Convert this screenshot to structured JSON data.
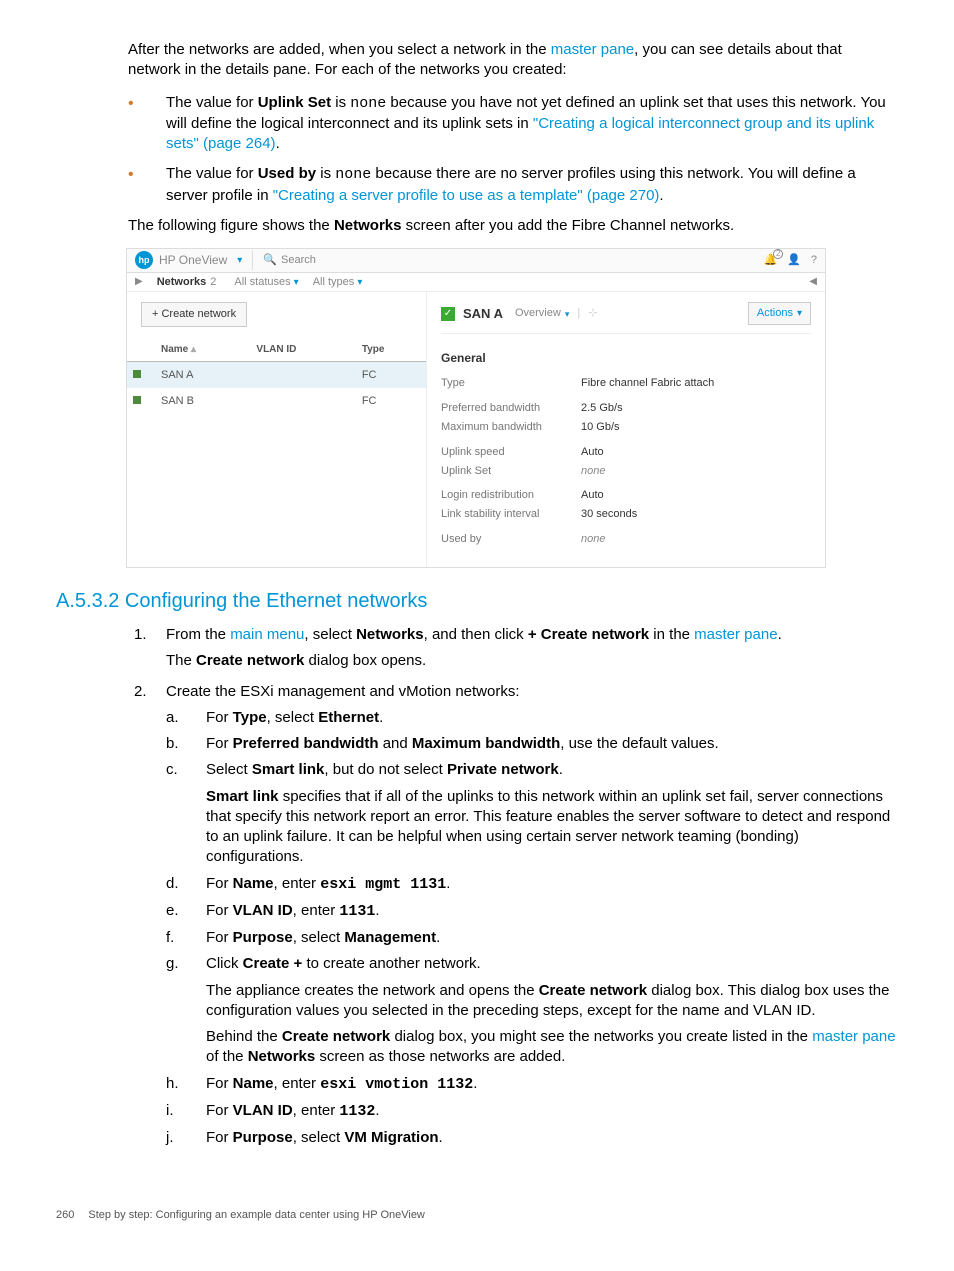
{
  "intro": {
    "p1a": "After the networks are added, when you select a network in the ",
    "p1link": "master pane",
    "p1b": ", you can see details about that network in the details pane. For each of the networks you created:",
    "b1a": "The value for ",
    "b1bold": "Uplink Set",
    "b1b": " is ",
    "b1mono": "none",
    "b1c": " because you have not yet defined an uplink set that uses this network. You will define the logical interconnect and its uplink sets in ",
    "b1link": "\"Creating a logical interconnect group and its uplink sets\" (page 264)",
    "b1d": ".",
    "b2a": "The value for ",
    "b2bold": "Used by",
    "b2b": " is ",
    "b2mono": "none",
    "b2c": " because there are no server profiles using this network. You will define a server profile in ",
    "b2link": "\"Creating a server profile to use as a template\" (page 270)",
    "b2d": ".",
    "p2a": "The following figure shows the ",
    "p2bold": "Networks",
    "p2b": " screen after you add the Fibre Channel networks."
  },
  "shot": {
    "topTitle": "HP OneView",
    "search": "Search",
    "badge": "2",
    "subLabel": "Networks",
    "subCount": "2",
    "filter1": "All statuses",
    "filter2": "All types",
    "createBtn": "+ Create network",
    "cols": {
      "name": "Name",
      "vlan": "VLAN ID",
      "type": "Type"
    },
    "rows": [
      {
        "name": "SAN A",
        "vlan": "",
        "type": "FC",
        "sel": true
      },
      {
        "name": "SAN B",
        "vlan": "",
        "type": "FC",
        "sel": false
      }
    ],
    "rp": {
      "title": "SAN A",
      "overview": "Overview",
      "actions": "Actions",
      "general": "General",
      "kv": [
        [
          {
            "k": "Type",
            "v": "Fibre channel Fabric attach"
          }
        ],
        [
          {
            "k": "Preferred bandwidth",
            "v": "2.5 Gb/s"
          },
          {
            "k": "Maximum bandwidth",
            "v": "10 Gb/s"
          }
        ],
        [
          {
            "k": "Uplink speed",
            "v": "Auto"
          },
          {
            "k": "Uplink Set",
            "v": "none",
            "it": true
          }
        ],
        [
          {
            "k": "Login redistribution",
            "v": "Auto"
          },
          {
            "k": "Link stability interval",
            "v": "30 seconds"
          }
        ],
        [
          {
            "k": "Used by",
            "v": "none",
            "it": true
          }
        ]
      ]
    }
  },
  "section": {
    "heading": "A.5.3.2 Configuring the Ethernet networks",
    "step1a": "From the ",
    "step1link1": "main menu",
    "step1b": ", select ",
    "step1bold1": "Networks",
    "step1c": ", and then click ",
    "step1bold2": "+ Create network",
    "step1d": " in the ",
    "step1link2": "master pane",
    "step1e": ".",
    "step1p2a": "The ",
    "step1p2bold": "Create network",
    "step1p2b": " dialog box opens.",
    "step2": "Create the ESXi management and vMotion networks:",
    "sa": {
      "t1": "For ",
      "b1": "Type",
      "t2": ", select ",
      "b2": "Ethernet",
      "t3": "."
    },
    "sb": {
      "t1": "For ",
      "b1": "Preferred bandwidth",
      "t2": " and ",
      "b2": "Maximum bandwidth",
      "t3": ", use the default values."
    },
    "sc": {
      "t1": "Select ",
      "b1": "Smart link",
      "t2": ", but do not select ",
      "b2": "Private network",
      "t3": ".",
      "p2b": "Smart link",
      "p2t": " specifies that if all of the uplinks to this network within an uplink set fail, server connections that specify this network report an error. This feature enables the server software to detect and respond to an uplink failure. It can be helpful when using certain server network teaming (bonding) configurations."
    },
    "sd": {
      "t1": "For ",
      "b1": "Name",
      "t2": ", enter ",
      "m": "esxi mgmt 1131",
      "t3": "."
    },
    "se": {
      "t1": "For ",
      "b1": "VLAN ID",
      "t2": ", enter ",
      "m": "1131",
      "t3": "."
    },
    "sf": {
      "t1": "For ",
      "b1": "Purpose",
      "t2": ", select ",
      "b2": "Management",
      "t3": "."
    },
    "sg": {
      "t1": "Click ",
      "b1": "Create +",
      "t2": " to create another network.",
      "p2a": "The appliance creates the network and opens the ",
      "p2b": "Create network",
      "p2c": " dialog box. This dialog box uses the configuration values you selected in the preceding steps, except for the name and VLAN ID.",
      "p3a": "Behind the ",
      "p3b": "Create network",
      "p3c": " dialog box, you might see the networks you create listed in the ",
      "p3link": "master pane",
      "p3d": " of the ",
      "p3bold": "Networks",
      "p3e": " screen as those networks are added."
    },
    "sh": {
      "t1": "For ",
      "b1": "Name",
      "t2": ", enter ",
      "m": "esxi vmotion 1132",
      "t3": "."
    },
    "si": {
      "t1": "For ",
      "b1": "VLAN ID",
      "t2": ", enter ",
      "m": "1132",
      "t3": "."
    },
    "sj": {
      "t1": "For ",
      "b1": "Purpose",
      "t2": ", select ",
      "b2": "VM Migration",
      "t3": "."
    }
  },
  "footer": {
    "page": "260",
    "text": "Step by step: Configuring an example data center using HP OneView"
  }
}
